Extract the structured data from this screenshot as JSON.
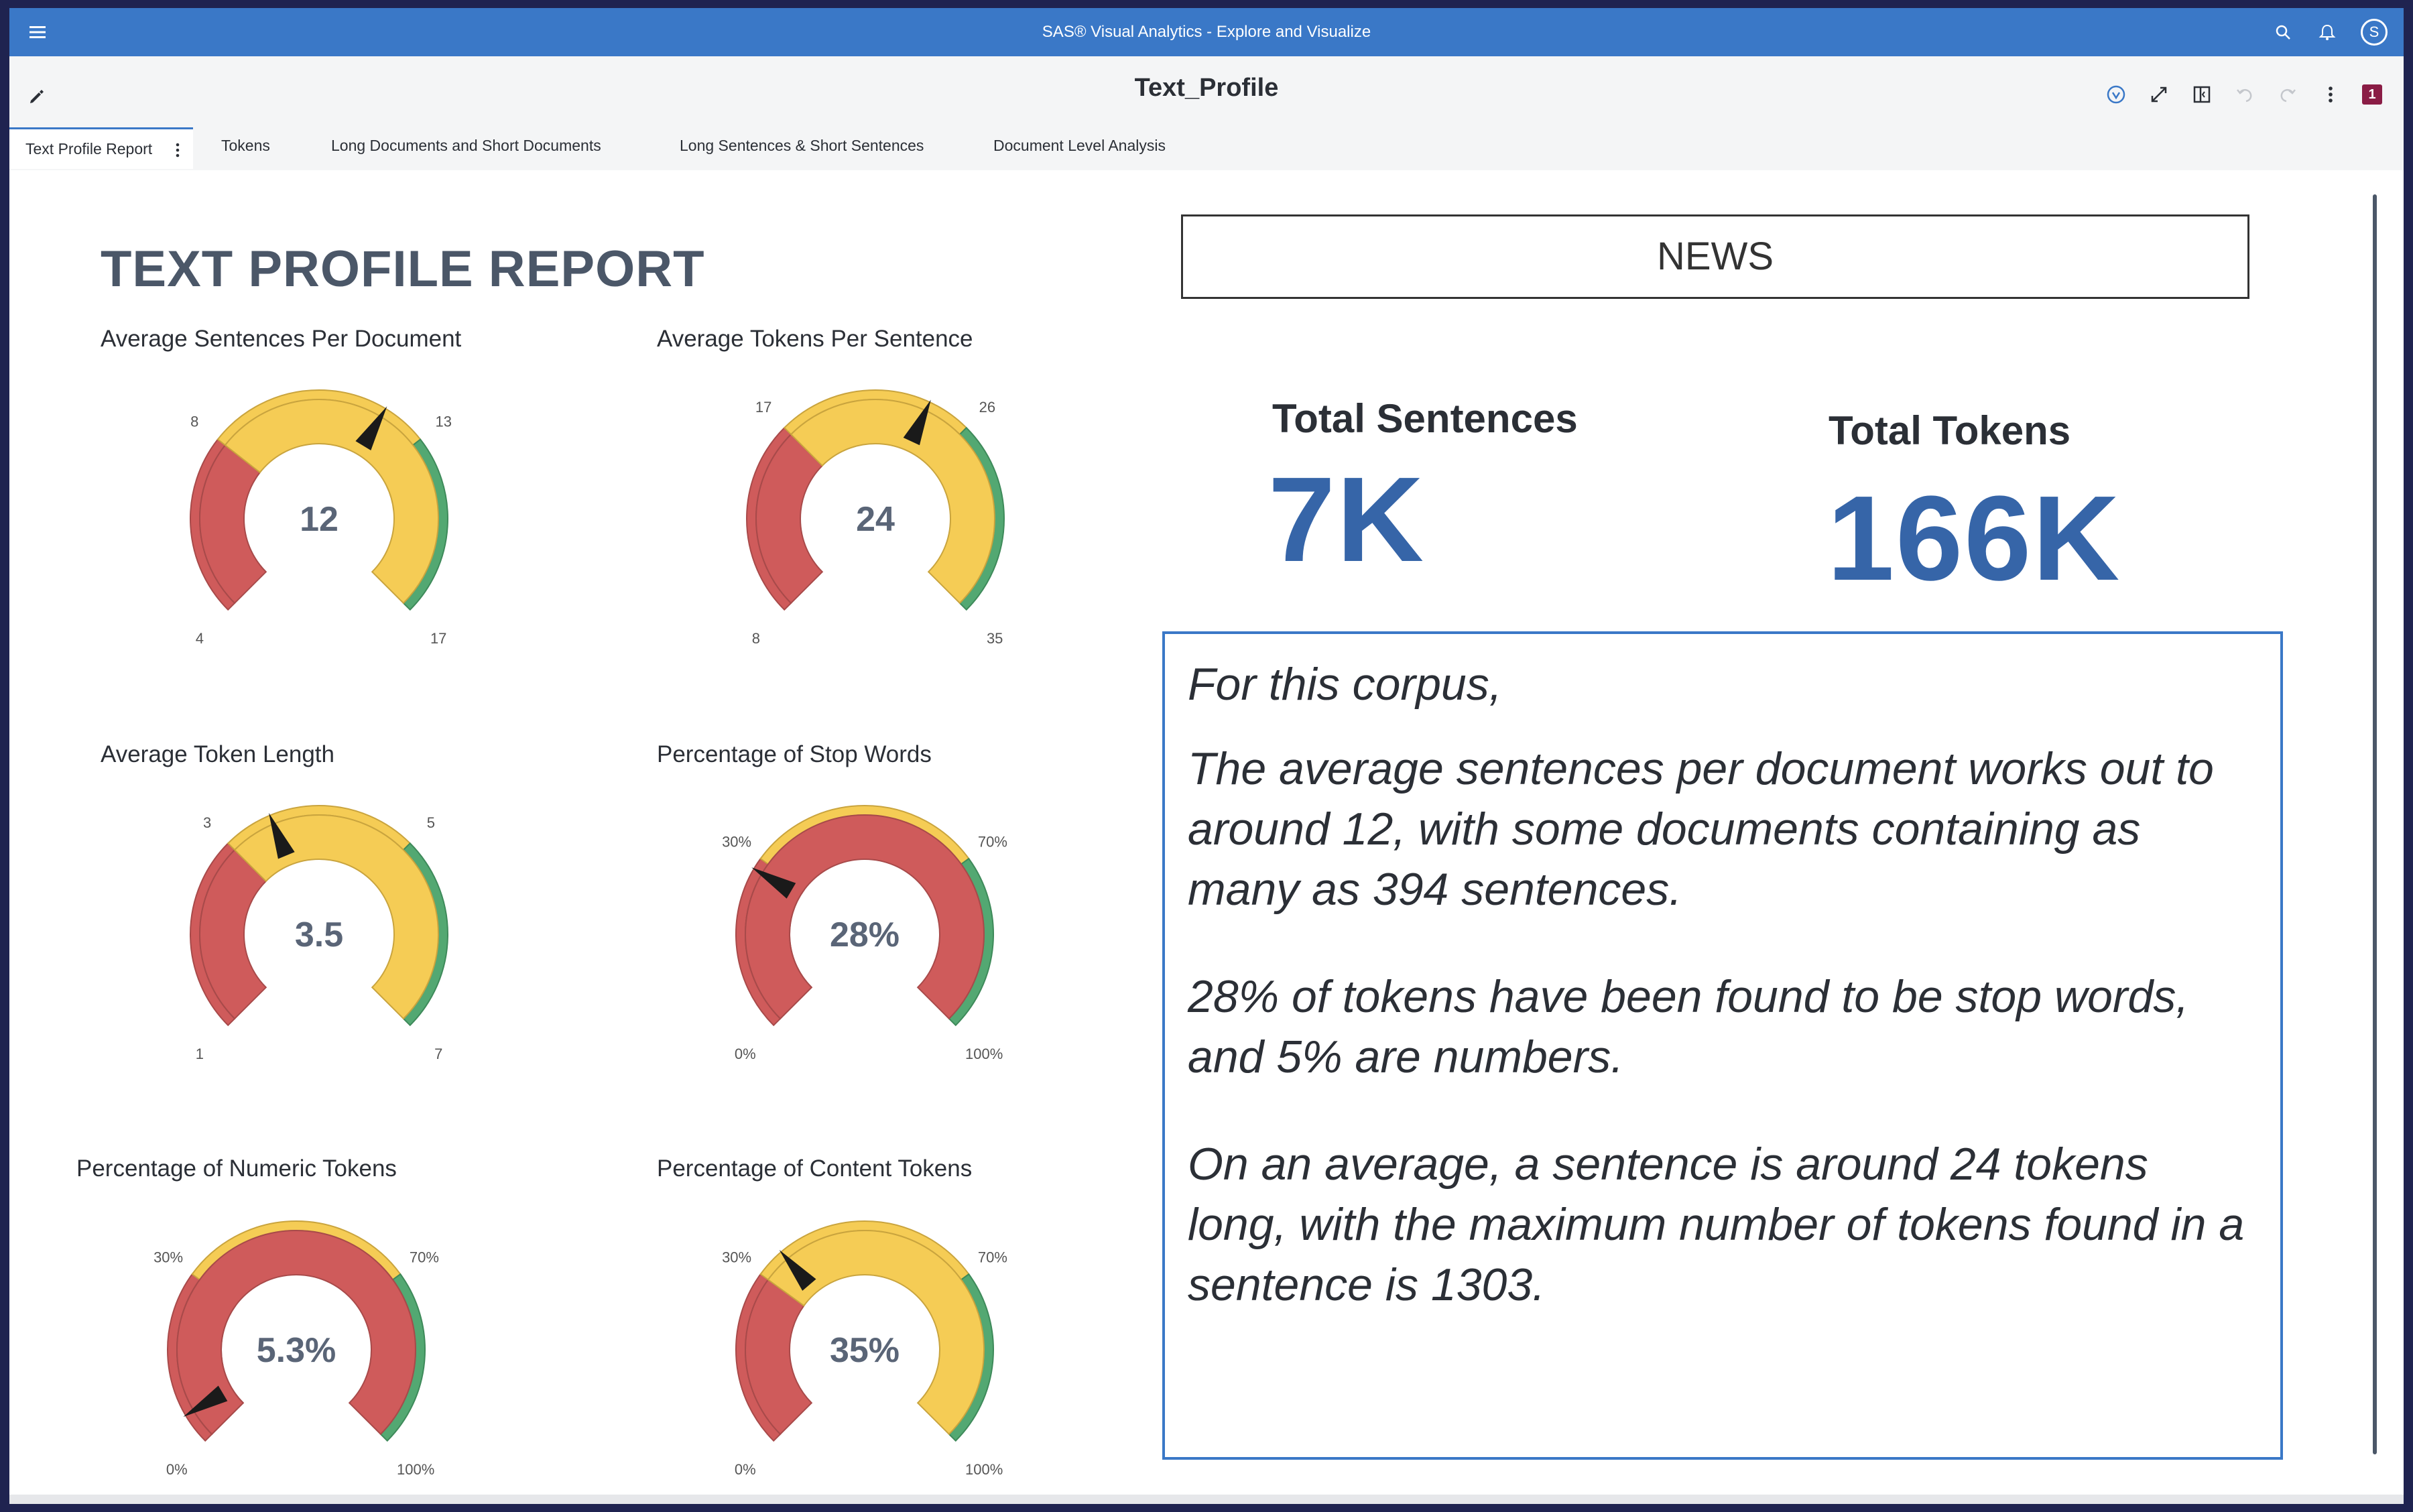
{
  "app_bar": {
    "title": "SAS® Visual Analytics - Explore and Visualize",
    "avatar_letter": "S"
  },
  "report": {
    "title": "Text_Profile",
    "badge": "1"
  },
  "tabs": [
    {
      "label": "Text Profile Report",
      "active": true
    },
    {
      "label": "Tokens"
    },
    {
      "label": "Long Documents and Short Documents"
    },
    {
      "label": "Long Sentences & Short Sentences"
    },
    {
      "label": "Document Level Analysis"
    }
  ],
  "page": {
    "heading": "TEXT PROFILE REPORT"
  },
  "colors": {
    "red": "#cf5b5b",
    "yellow": "#f5cc55",
    "green": "#53a872",
    "accent": "#3a78c7",
    "kpi": "#3665a8"
  },
  "gauges": [
    {
      "label": "Average Sentences Per Document",
      "value": 12,
      "display": "12",
      "min": 4,
      "max": 17,
      "t1": 8,
      "t2": 13,
      "min_label": "4",
      "max_label": "17",
      "t1_label": "8",
      "t2_label": "13",
      "fill": "yellow"
    },
    {
      "label": "Average Tokens Per Sentence",
      "value": 24,
      "display": "24",
      "min": 8,
      "max": 35,
      "t1": 17,
      "t2": 26,
      "min_label": "8",
      "max_label": "35",
      "t1_label": "17",
      "t2_label": "26",
      "fill": "yellow"
    },
    {
      "label": "Average Token Length",
      "value": 3.5,
      "display": "3.5",
      "min": 1,
      "max": 7,
      "t1": 3,
      "t2": 5,
      "min_label": "1",
      "max_label": "7",
      "t1_label": "3",
      "t2_label": "5",
      "fill": "yellow"
    },
    {
      "label": "Percentage of Stop Words",
      "value": 28,
      "display": "28%",
      "min": 0,
      "max": 100,
      "t1": 30,
      "t2": 70,
      "min_label": "0%",
      "max_label": "100%",
      "t1_label": "30%",
      "t2_label": "70%",
      "fill": "red"
    },
    {
      "label": "Percentage of Numeric Tokens",
      "value": 5.3,
      "display": "5.3%",
      "min": 0,
      "max": 100,
      "t1": 30,
      "t2": 70,
      "min_label": "0%",
      "max_label": "100%",
      "t1_label": "30%",
      "t2_label": "70%",
      "fill": "red"
    },
    {
      "label": "Percentage of Content Tokens",
      "value": 35,
      "display": "35%",
      "min": 0,
      "max": 100,
      "t1": 30,
      "t2": 70,
      "min_label": "0%",
      "max_label": "100%",
      "t1_label": "30%",
      "t2_label": "70%",
      "fill": "yellow"
    }
  ],
  "news_label": "NEWS",
  "kpis": {
    "sentences": {
      "title": "Total Sentences",
      "value": "7K"
    },
    "tokens": {
      "title": "Total Tokens",
      "value": "166K"
    }
  },
  "summary": {
    "p1": "For this corpus,",
    "p2": "The average sentences per document works out to around  12, with some documents containing as many as 394 sentences.",
    "p3": "28% of tokens have been found to be stop words, and 5% are numbers.",
    "p4": "On an average, a sentence is around 24 tokens long, with the maximum number of tokens found in a sentence is  1303."
  },
  "icons": [
    "menu-icon",
    "search-icon",
    "bell-icon",
    "edit-icon",
    "info-icon",
    "expand-icon",
    "panel-icon",
    "undo-icon",
    "redo-icon",
    "more-icon"
  ]
}
